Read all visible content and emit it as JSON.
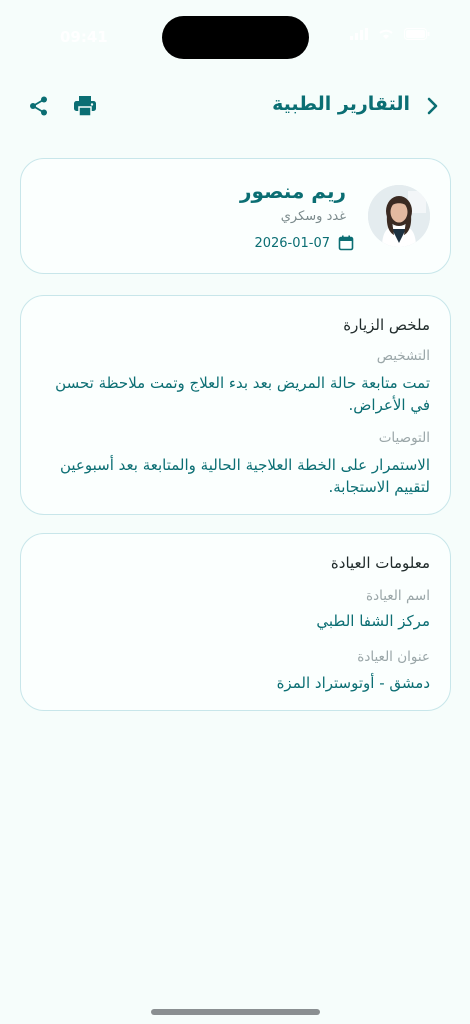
{
  "status_bar": {
    "time": "09:41"
  },
  "header": {
    "title": "التقارير الطبية",
    "back_icon": "chevron-right-icon",
    "share_icon": "share-icon",
    "print_icon": "printer-icon"
  },
  "patient": {
    "name": "ريم منصور",
    "condition": "غدد وسكري",
    "date": "2026-01-07",
    "date_icon": "calendar-icon"
  },
  "summary": {
    "title": "ملخص الزيارة",
    "diagnosis_label": "التشخيص",
    "diagnosis_value": "تمت متابعة حالة المريض بعد بدء العلاج وتمت ملاحظة تحسن في الأعراض.",
    "recommendations_label": "التوصيات",
    "recommendations_value": "الاستمرار على الخطة العلاجية الحالية والمتابعة بعد أسبوعين لتقييم الاستجابة."
  },
  "clinic": {
    "title": "معلومات العيادة",
    "name_label": "اسم العيادة",
    "name_value": "مركز الشفا الطبي",
    "address_label": "عنوان العيادة",
    "address_value": "دمشق - أوتوستراد المزة"
  },
  "colors": {
    "accent": "#0b6e73",
    "background": "#f6fdfb",
    "card_border": "#c8e6ea",
    "muted_text": "#9aa6a8"
  }
}
